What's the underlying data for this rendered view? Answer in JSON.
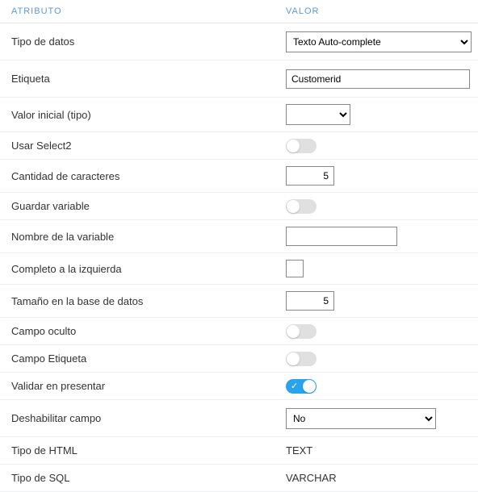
{
  "headers": {
    "attribute": "ATRIBUTO",
    "value": "VALOR"
  },
  "rows": {
    "dataType": {
      "label": "Tipo de datos",
      "value": "Texto Auto-complete"
    },
    "etiqueta": {
      "label": "Etiqueta",
      "value": "Customerid"
    },
    "valorInicial": {
      "label": "Valor inicial (tipo)",
      "value": ""
    },
    "select2": {
      "label": "Usar Select2"
    },
    "cantChars": {
      "label": "Cantidad de caracteres",
      "value": "5"
    },
    "guardarVar": {
      "label": "Guardar variable"
    },
    "nombreVar": {
      "label": "Nombre de la variable",
      "value": ""
    },
    "completoIzq": {
      "label": "Completo a la izquierda"
    },
    "tamanoDb": {
      "label": "Tamaño en la base de datos",
      "value": "5"
    },
    "campoOculto": {
      "label": "Campo oculto"
    },
    "campoEtiq": {
      "label": "Campo Etiqueta"
    },
    "validar": {
      "label": "Validar en presentar"
    },
    "deshab": {
      "label": "Deshabilitar campo",
      "value": "No"
    },
    "htmlType": {
      "label": "Tipo de HTML",
      "value": "TEXT"
    },
    "sqlType": {
      "label": "Tipo de SQL",
      "value": "VARCHAR"
    }
  }
}
